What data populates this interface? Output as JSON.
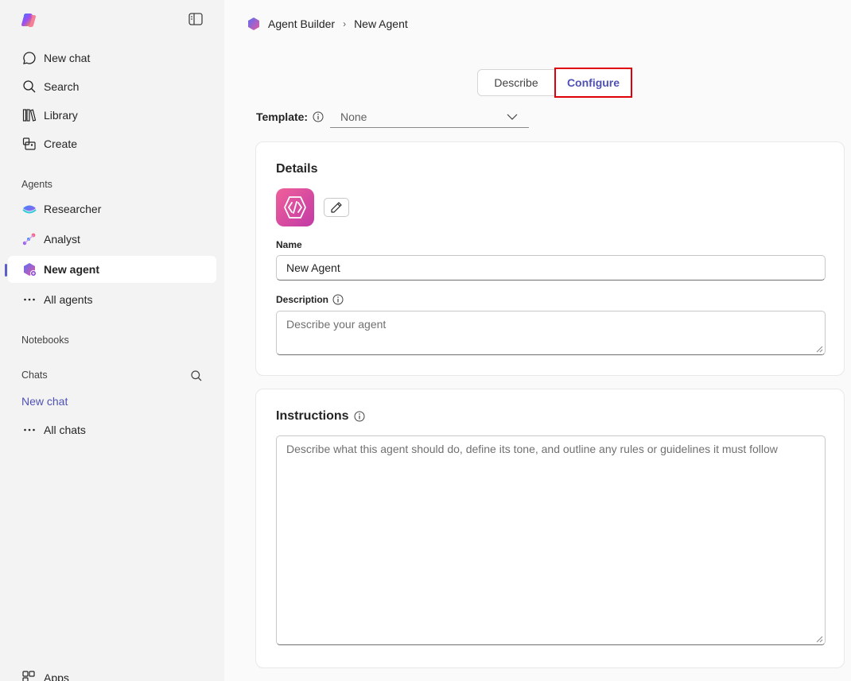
{
  "breadcrumb": {
    "root": "Agent Builder",
    "current": "New Agent"
  },
  "sidebar": {
    "items": [
      {
        "label": "New chat",
        "icon": "chat-bubble-icon"
      },
      {
        "label": "Search",
        "icon": "search-icon"
      },
      {
        "label": "Library",
        "icon": "library-icon"
      },
      {
        "label": "Create",
        "icon": "create-icon"
      }
    ],
    "agents_label": "Agents",
    "agents": [
      {
        "label": "Researcher",
        "icon": "researcher-icon"
      },
      {
        "label": "Analyst",
        "icon": "analyst-icon"
      },
      {
        "label": "New agent",
        "icon": "new-agent-icon",
        "active": true
      },
      {
        "label": "All agents",
        "icon": "more-icon"
      }
    ],
    "notebooks_label": "Notebooks",
    "chats_label": "Chats",
    "chats_new": "New chat",
    "chats_all": "All chats",
    "apps": "Apps"
  },
  "tabs": {
    "describe": "Describe",
    "configure": "Configure",
    "selected": "Configure"
  },
  "template": {
    "label": "Template:",
    "value": "None"
  },
  "details": {
    "title": "Details",
    "name_label": "Name",
    "name_value": "New Agent",
    "description_label": "Description",
    "description_placeholder": "Describe your agent"
  },
  "instructions": {
    "title": "Instructions",
    "placeholder": "Describe what this agent should do, define its tone, and outline any rules or guidelines it must follow"
  },
  "colors": {
    "accent": "#4f52b2",
    "highlight": "#e0000a",
    "sidebar_bg": "#f3f3f3"
  }
}
